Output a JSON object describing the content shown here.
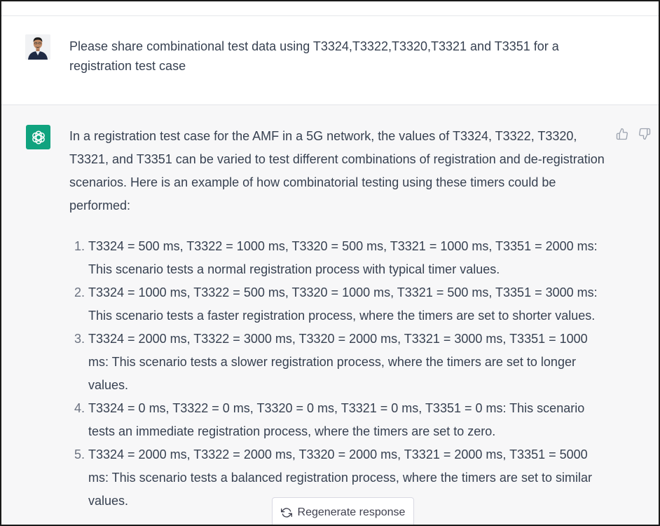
{
  "user_message": {
    "avatar": "user-avatar-photo",
    "text": "Please share combinational test data using T3324,T3322,T3320,T3321 and T3351 for a registration test case"
  },
  "assistant_message": {
    "avatar": "openai-logo-icon",
    "intro": "In a registration test case for the AMF in a 5G network, the values of T3324, T3322, T3320, T3321, and T3351 can be varied to test different combinations of registration and de-registration scenarios. Here is an example of how combinatorial testing using these timers could be performed:",
    "items": [
      "T3324 = 500 ms, T3322 = 1000 ms, T3320 = 500 ms, T3321 = 1000 ms, T3351 = 2000 ms: This scenario tests a normal registration process with typical timer values.",
      "T3324 = 1000 ms, T3322 = 500 ms, T3320 = 1000 ms, T3321 = 500 ms, T3351 = 3000 ms: This scenario tests a faster registration process, where the timers are set to shorter values.",
      "T3324 = 2000 ms, T3322 = 3000 ms, T3320 = 2000 ms, T3321 = 3000 ms, T3351 = 1000 ms: This scenario tests a slower registration process, where the timers are set to longer values.",
      "T3324 = 0 ms, T3322 = 0 ms, T3320 = 0 ms, T3321 = 0 ms, T3351 = 0 ms: This scenario tests an immediate registration process, where the timers are set to zero.",
      "T3324 = 2000 ms, T3322 = 2000 ms, T3320 = 2000 ms, T3321 = 2000 ms, T3351 = 5000 ms: This scenario tests a balanced registration process, where the timers are set to similar values."
    ],
    "feedback_icons": [
      "thumbs-up-icon",
      "thumbs-down-icon"
    ]
  },
  "regenerate": {
    "label": "Regenerate response",
    "icon": "refresh-icon"
  },
  "colors": {
    "assistant_bg": "#f7f7f8",
    "brand_green": "#10a37f",
    "text": "#374151"
  }
}
